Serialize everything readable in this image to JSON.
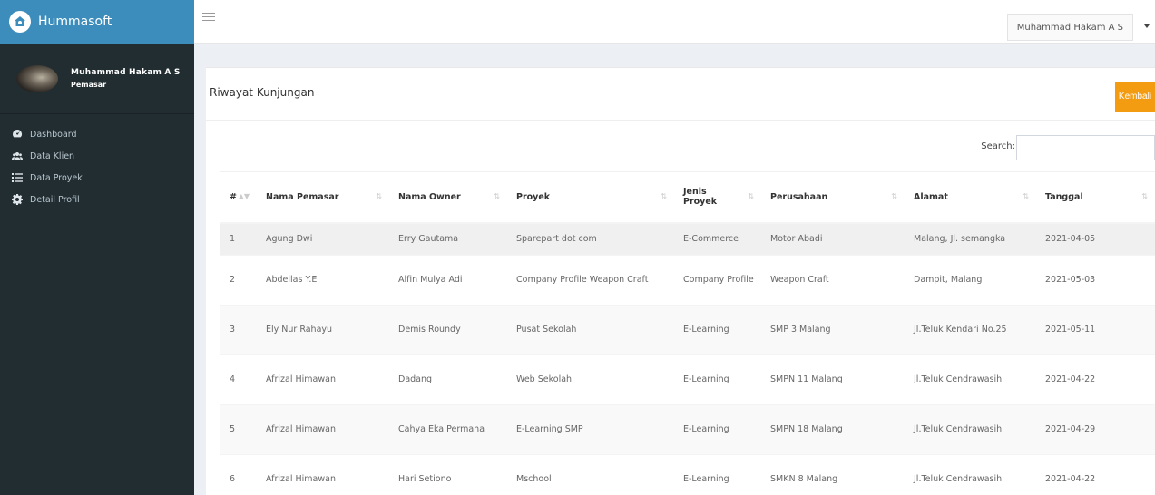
{
  "app": {
    "brand": "Hummasoft"
  },
  "user": {
    "name": "Muhammad Hakam A S",
    "role": "Pemasar"
  },
  "sidebar": {
    "items": [
      {
        "label": "Dashboard",
        "icon": "dashboard-icon"
      },
      {
        "label": "Data Klien",
        "icon": "users-icon"
      },
      {
        "label": "Data Proyek",
        "icon": "list-icon"
      },
      {
        "label": "Detail Profil",
        "icon": "gear-icon"
      }
    ]
  },
  "navbar": {
    "user_label": "Muhammad Hakam A S"
  },
  "page": {
    "title": "Riwayat Kunjungan",
    "back_button": "Kembali",
    "search_label": "Search:",
    "search_value": ""
  },
  "table": {
    "headers": [
      "#",
      "Nama Pemasar",
      "Nama Owner",
      "Proyek",
      "Jenis Proyek",
      "Perusahaan",
      "Alamat",
      "Tanggal"
    ],
    "rows": [
      [
        "1",
        "Agung Dwi",
        "Erry Gautama",
        "Sparepart dot com",
        "E-Commerce",
        "Motor Abadi",
        "Malang, Jl. semangka",
        "2021-04-05"
      ],
      [
        "2",
        "Abdellas Y.E",
        "Alfin Mulya Adi",
        "Company Profile Weapon Craft",
        "Company Profile",
        "Weapon Craft",
        "Dampit, Malang",
        "2021-05-03"
      ],
      [
        "3",
        "Ely Nur Rahayu",
        "Demis Roundy",
        "Pusat Sekolah",
        "E-Learning",
        "SMP 3 Malang",
        "Jl.Teluk Kendari No.25",
        "2021-05-11"
      ],
      [
        "4",
        "Afrizal Himawan",
        "Dadang",
        "Web Sekolah",
        "E-Learning",
        "SMPN 11 Malang",
        "Jl.Teluk Cendrawasih",
        "2021-04-22"
      ],
      [
        "5",
        "Afrizal Himawan",
        "Cahya Eka Permana",
        "E-Learning SMP",
        "E-Learning",
        "SMPN 18 Malang",
        "Jl.Teluk Cendrawasih",
        "2021-04-29"
      ],
      [
        "6",
        "Afrizal Himawan",
        "Hari Setiono",
        "Mschool",
        "E-Learning",
        "SMKN 8 Malang",
        "Jl.Teluk Cendrawasih",
        "2021-04-22"
      ]
    ]
  },
  "colors": {
    "sidebar_bg": "#222d32",
    "logo_bg": "#3c8dbc",
    "warning_button": "#f39c12"
  }
}
